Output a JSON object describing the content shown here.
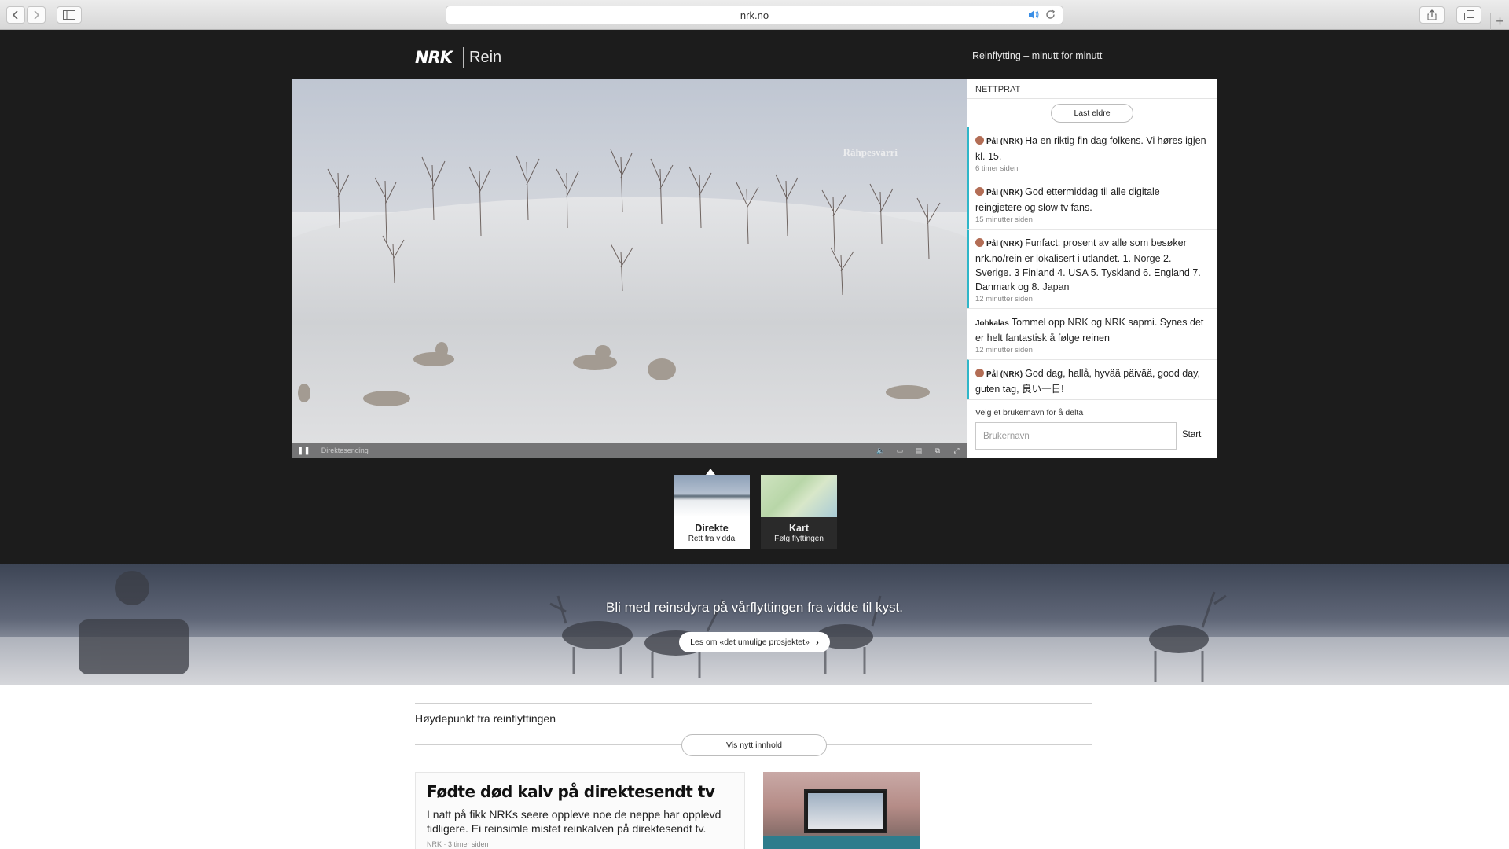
{
  "browser": {
    "url": "nrk.no",
    "icons": [
      "back-icon",
      "forward-icon",
      "sidebar-icon",
      "speaker-icon",
      "reload-icon",
      "share-icon",
      "tabs-icon",
      "plus-icon"
    ]
  },
  "site": {
    "logo": "NRK",
    "section": "Rein",
    "header_link": "Reinflytting – minutt for minutt"
  },
  "video": {
    "location": "Ráhpesvárri",
    "status": "Direktesending"
  },
  "chat": {
    "title": "NETTPRAT",
    "load_older": "Last eldre",
    "messages": [
      {
        "author": "Pål (NRK)",
        "text": "Ha en riktig fin dag folkens. Vi høres igjen kl. 15.",
        "time": "6 timer siden",
        "staff": true
      },
      {
        "author": "Pål (NRK)",
        "text": "God ettermiddag til alle digitale reingjetere og slow tv fans.",
        "time": "15 minutter siden",
        "staff": true
      },
      {
        "author": "Pål (NRK)",
        "text": "Funfact: prosent av alle som besøker nrk.no/rein er lokalisert i utlandet. 1. Norge 2. Sverige. 3 Finland 4. USA 5. Tyskland 6. England 7. Danmark og 8. Japan",
        "time": "12 minutter siden",
        "staff": true
      },
      {
        "author": "Johkalas",
        "text": "Tommel opp NRK og NRK sapmi. Synes det er helt fantastisk å følge reinen",
        "time": "12 minutter siden",
        "staff": false
      },
      {
        "author": "Pål (NRK)",
        "text": "God dag, hallå, hyvää päivää, good day, guten tag, 良い一日!",
        "time": "",
        "staff": true
      }
    ],
    "join_label": "Velg et brukernavn for å delta",
    "username_placeholder": "Brukernavn",
    "start_label": "Start"
  },
  "tabs": [
    {
      "title": "Direkte",
      "subtitle": "Rett fra vidda",
      "active": true
    },
    {
      "title": "Kart",
      "subtitle": "Følg flyttingen",
      "active": false
    }
  ],
  "banner": {
    "text": "Bli med reinsdyra på vårflyttingen fra vidde til kyst.",
    "cta": "Les om «det umulige prosjektet»"
  },
  "highlights": {
    "heading": "Høydepunkt fra reinflyttingen",
    "show_new": "Vis nytt innhold",
    "article": {
      "title": "Fødte død kalv på direktesendt tv",
      "lead": "I natt på fikk NRKs seere oppleve noe de neppe har opplevd tidligere. Ei reinsimle mistet reinkalven på direktesendt tv.",
      "meta": "NRK · 3 timer siden"
    }
  },
  "colors": {
    "header_bg": "#1c1c1c",
    "staff_accent": "#2fb6c8",
    "speaker_blue": "#3a8ee6"
  }
}
